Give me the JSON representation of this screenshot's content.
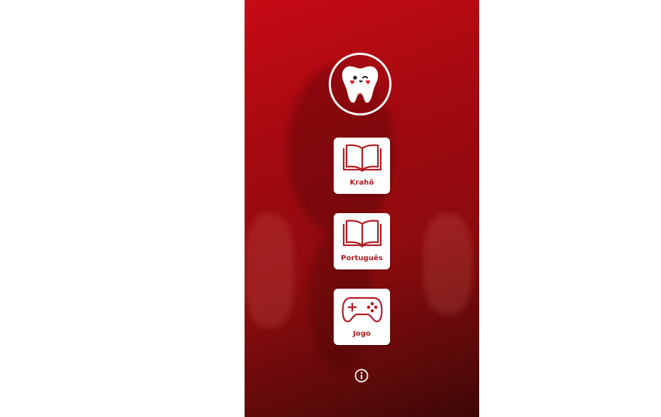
{
  "app": {
    "background_color": "#a10a10",
    "accent_color": "#b11a1f"
  },
  "logo": {
    "icon": "tooth-mascot-icon"
  },
  "menu": {
    "items": [
      {
        "label": "Krahô",
        "icon": "open-book-icon"
      },
      {
        "label": "Português",
        "icon": "open-book-icon"
      },
      {
        "label": "Jogo",
        "icon": "gamepad-icon"
      }
    ]
  },
  "footer": {
    "info_icon": "info-icon"
  }
}
